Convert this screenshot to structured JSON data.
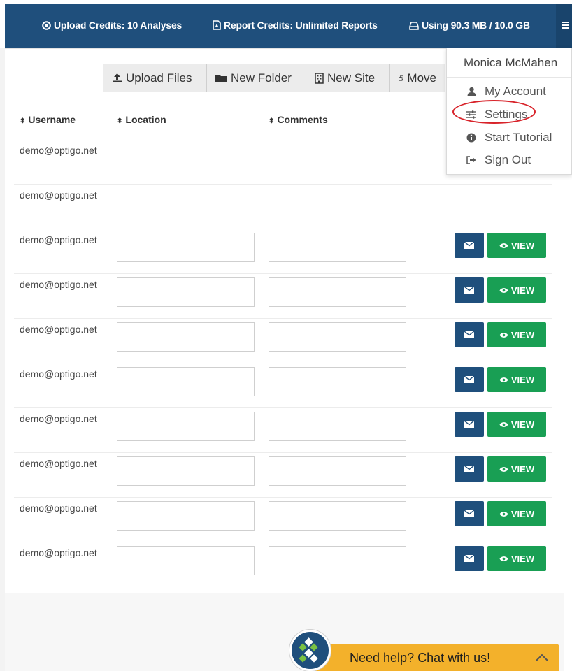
{
  "header": {
    "upload_credits": "Upload Credits: 10 Analyses",
    "report_credits": "Report Credits: Unlimited Reports",
    "storage": "Using 90.3 MB / 10.0 GB"
  },
  "toolbar": {
    "upload_files": "Upload Files",
    "new_folder": "New Folder",
    "new_site": "New Site",
    "move": "Move"
  },
  "table": {
    "columns": [
      "Username",
      "Location",
      "Comments"
    ],
    "rows": [
      {
        "username": "demo@optigo.net"
      },
      {
        "username": "demo@optigo.net"
      },
      {
        "username": "demo@optigo.net",
        "view_label": "VIEW"
      },
      {
        "username": "demo@optigo.net",
        "view_label": "VIEW"
      },
      {
        "username": "demo@optigo.net",
        "view_label": "VIEW"
      },
      {
        "username": "demo@optigo.net",
        "view_label": "VIEW"
      },
      {
        "username": "demo@optigo.net",
        "view_label": "VIEW"
      },
      {
        "username": "demo@optigo.net",
        "view_label": "VIEW"
      },
      {
        "username": "demo@optigo.net",
        "view_label": "VIEW"
      },
      {
        "username": "demo@optigo.net",
        "view_label": "VIEW"
      }
    ]
  },
  "user_menu": {
    "name": "Monica McMahen",
    "items": [
      {
        "label": "My Account",
        "icon": "user-icon"
      },
      {
        "label": "Settings",
        "icon": "sliders-icon"
      },
      {
        "label": "Start Tutorial",
        "icon": "info-icon"
      },
      {
        "label": "Sign Out",
        "icon": "sign-out-icon"
      }
    ]
  },
  "chat": {
    "label": "Need help? Chat with us!"
  },
  "colors": {
    "navbar": "#1f4f7c",
    "view_button": "#199f54",
    "chat": "#f3b12b",
    "highlight_ring": "#d8232a"
  }
}
